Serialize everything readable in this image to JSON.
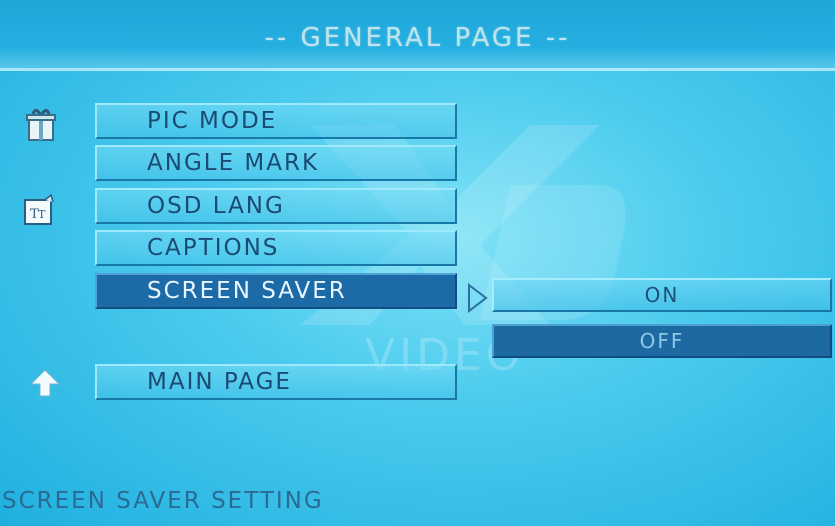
{
  "header": {
    "title": "-- GENERAL PAGE --"
  },
  "watermark": {
    "text": "VIDEO",
    "logo": "xd-logo"
  },
  "side_icons": [
    "gift-box-icon",
    "text-document-icon",
    "up-arrow-icon"
  ],
  "menu": {
    "items": [
      {
        "label": "PIC MODE",
        "selected": false
      },
      {
        "label": "ANGLE MARK",
        "selected": false
      },
      {
        "label": "OSD LANG",
        "selected": false
      },
      {
        "label": "CAPTIONS",
        "selected": false
      },
      {
        "label": "SCREEN SAVER",
        "selected": true
      }
    ],
    "main_page_label": "MAIN PAGE"
  },
  "submenu": {
    "options": [
      {
        "label": "ON",
        "selected": false
      },
      {
        "label": "OFF",
        "selected": true
      }
    ]
  },
  "status": {
    "text": "SCREEN SAVER SETTING"
  },
  "colors": {
    "background": "#4ccbee",
    "selected": "#1c6aa6",
    "text": "#1b4a72"
  }
}
